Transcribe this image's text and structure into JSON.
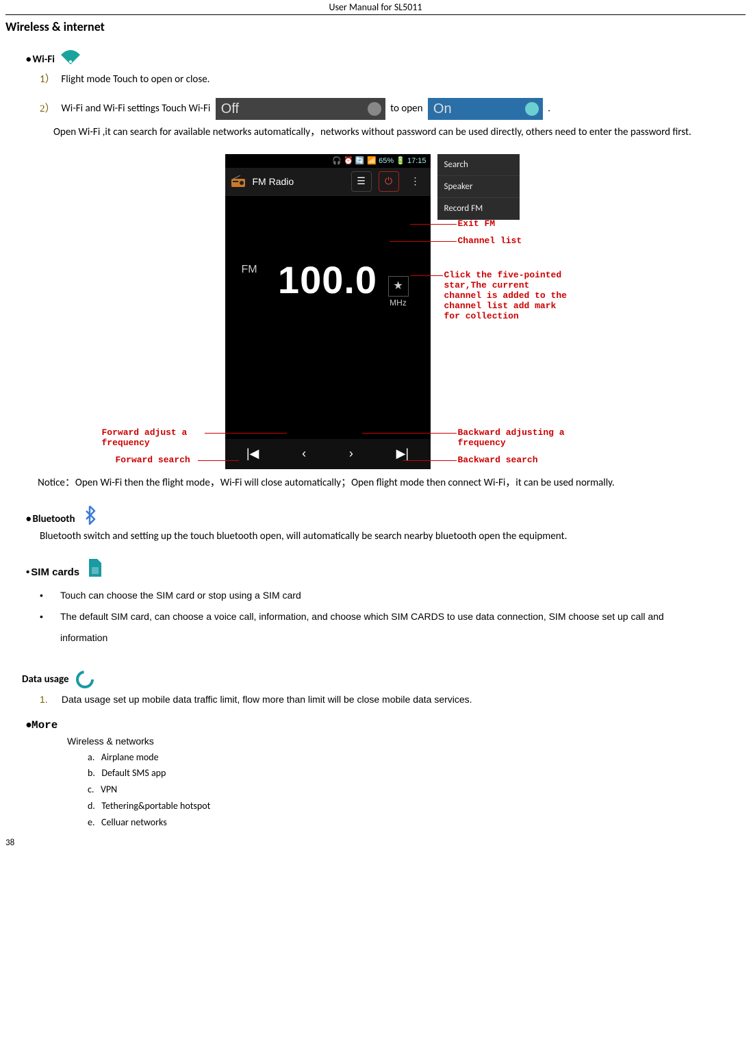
{
  "header": {
    "title": "User Manual for SL5011"
  },
  "section_title": "Wireless & internet",
  "wifi": {
    "label": "Wi-Fi",
    "item1_num": "1）",
    "item1_text": "Flight mode      Touch to open or close.",
    "item2_num": "2）",
    "item2_a": "Wi-Fi and Wi-Fi settings       Touch Wi-Fi",
    "off_label": "Off",
    "item2_b": "to open",
    "on_label": "On",
    "item2_c": ".",
    "item2_desc": "Open Wi-Fi ,it can search for available networks automatically，networks without password can be used directly, others need to enter the password first."
  },
  "fm": {
    "status_right": "📶 65% 🔋 17:15",
    "app_title": "FM Radio",
    "fm_small": "FM",
    "freq": "100.0",
    "unit": "MHz",
    "menu": [
      "Search",
      "Speaker",
      "Record FM"
    ],
    "ann_exit": "Exit FM",
    "ann_channel": "Channel list",
    "ann_star": "Click the five-pointed star,The current channel is added to the channel list add mark for collection",
    "ann_fwd_adj": "Forward adjust a frequency",
    "ann_fwd_search": "Forward search",
    "ann_bwd_adj": "Backward adjusting a frequency",
    "ann_bwd_search": "Backward search"
  },
  "notice": "Notice：Open Wi-Fi then the flight mode，Wi-Fi will close automatically；Open flight mode then connect Wi-Fi，it can be used normally.",
  "bluetooth": {
    "label": "Bluetooth",
    "desc": "Bluetooth switch and setting up the touch bluetooth open, will automatically be search nearby bluetooth open the equipment."
  },
  "sim": {
    "label": "SIM cards",
    "items": [
      "Touch can choose the SIM card or stop using a SIM card",
      "The default SIM card, can choose a voice call, information, and choose which SIM CARDS to use data connection, SIM choose set up call and information"
    ]
  },
  "datausage": {
    "label": "Data usage",
    "item_num": "1.",
    "item_text": "Data usage    set up mobile data traffic limit, flow more than limit will be close mobile data services."
  },
  "more": {
    "label": "More",
    "subtitle": "Wireless & networks",
    "items": [
      "Airplane mode",
      "Default SMS app",
      "VPN",
      "Tethering&portable hotspot",
      "Celluar networks"
    ],
    "letters": [
      "a.",
      "b.",
      "c.",
      "d.",
      "e."
    ]
  },
  "page_number": "38"
}
